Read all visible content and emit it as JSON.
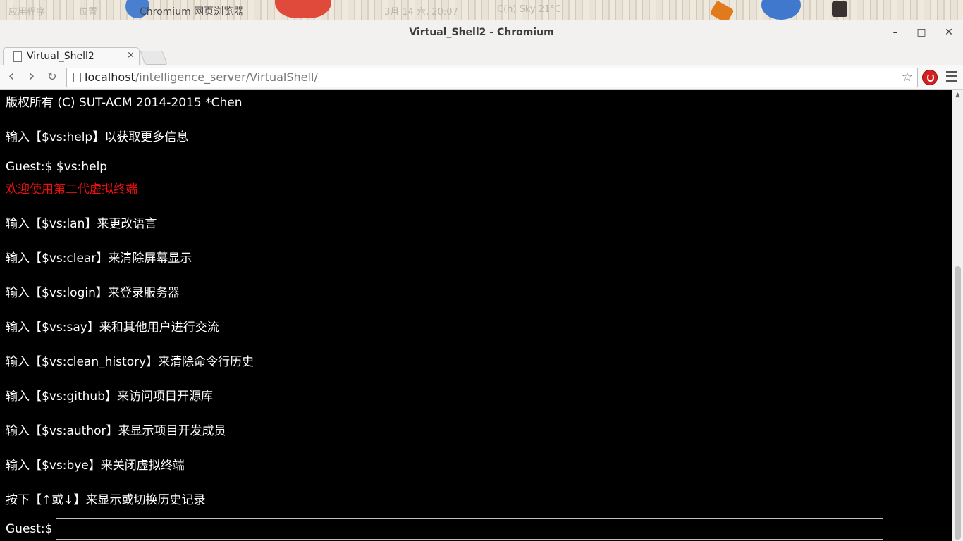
{
  "desktop_panel": {
    "items": [
      "应用程序",
      "位置",
      "Chromium 网页浏览器",
      "3月 14 六, 20:07",
      "C(h) Sky 21°C"
    ]
  },
  "window": {
    "title": "Virtual_Shell2 - Chromium",
    "minimize": "–",
    "maximize": "□",
    "close": "✕"
  },
  "tabs": [
    {
      "label": "Virtual_Shell2",
      "close": "×"
    }
  ],
  "toolbar": {
    "back": "‹",
    "forward": "›",
    "reload": "↻",
    "url_host": "localhost",
    "url_path": "/intelligence_server/VirtualShell/",
    "star": "☆"
  },
  "terminal": {
    "lines": [
      {
        "text": "版权所有 (C) SUT-ACM 2014-2015 *Chen",
        "color": "#ffffff"
      },
      {
        "text": "输入【$vs:help】以获取更多信息",
        "color": "#ffffff"
      },
      {
        "text": "Guest:$  $vs:help",
        "color": "#ffffff"
      },
      {
        "text": "欢迎使用第二代虚拟终端",
        "color": "#f01010"
      },
      {
        "text": "输入【$vs:lan】来更改语言",
        "color": "#ffffff"
      },
      {
        "text": "输入【$vs:clear】来清除屏幕显示",
        "color": "#ffffff"
      },
      {
        "text": "输入【$vs:login】来登录服务器",
        "color": "#ffffff"
      },
      {
        "text": "输入【$vs:say】来和其他用户进行交流",
        "color": "#ffffff"
      },
      {
        "text": "输入【$vs:clean_history】来清除命令行历史",
        "color": "#ffffff"
      },
      {
        "text": "输入【$vs:github】来访问项目开源库",
        "color": "#ffffff"
      },
      {
        "text": "输入【$vs:author】来显示项目开发成员",
        "color": "#ffffff"
      },
      {
        "text": "输入【$vs:bye】来关闭虚拟终端",
        "color": "#ffffff"
      },
      {
        "text": "按下【↑或↓】来显示或切换历史记录",
        "color": "#ffffff"
      }
    ],
    "prompt": "Guest:$",
    "input_value": ""
  }
}
